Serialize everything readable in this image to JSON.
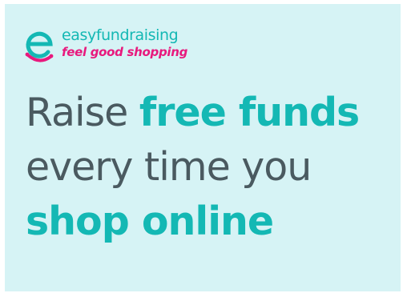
{
  "brand": {
    "name": "easyfundraising",
    "tagline": "feel good shopping",
    "logo_icon": "smiley-e-icon",
    "primary_color": "#14b8b4",
    "tagline_color": "#e8197d"
  },
  "headline": {
    "line1_plain": "Raise ",
    "line1_accent": "free funds",
    "line2_plain": "every time you",
    "line3_accent": "shop online"
  },
  "colors": {
    "background": "#d6f3f5",
    "text": "#4a5a60",
    "accent": "#14b8b4"
  }
}
